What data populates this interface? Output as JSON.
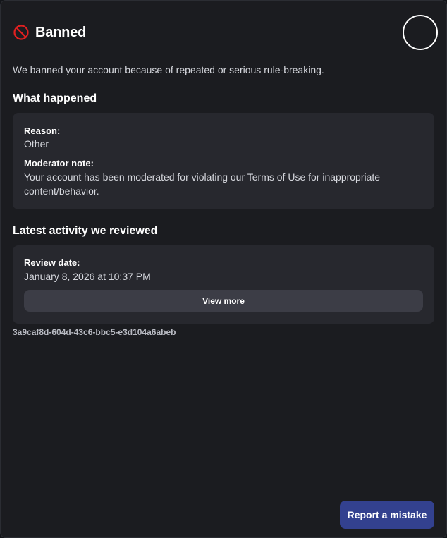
{
  "header": {
    "title": "Banned",
    "icon": "ban-icon"
  },
  "intro": "We banned your account because of repeated or serious rule-breaking.",
  "what_happened": {
    "title": "What happened",
    "reason_label": "Reason:",
    "reason_value": "Other",
    "note_label": "Moderator note:",
    "note_value": "Your account has been moderated for violating our Terms of Use for inappropriate content/behavior."
  },
  "latest_activity": {
    "title": "Latest activity we reviewed",
    "date_label": "Review date:",
    "date_value": "January 8, 2026 at 10:37 PM",
    "view_more_label": "View more"
  },
  "reference_id": "3a9caf8d-604d-43c6-bbc5-e3d104a6abeb",
  "footer": {
    "report_label": "Report a mistake"
  },
  "colors": {
    "background": "#1b1c20",
    "card": "#27282e",
    "ban_icon": "#e02020",
    "report_button": "#33418f"
  }
}
